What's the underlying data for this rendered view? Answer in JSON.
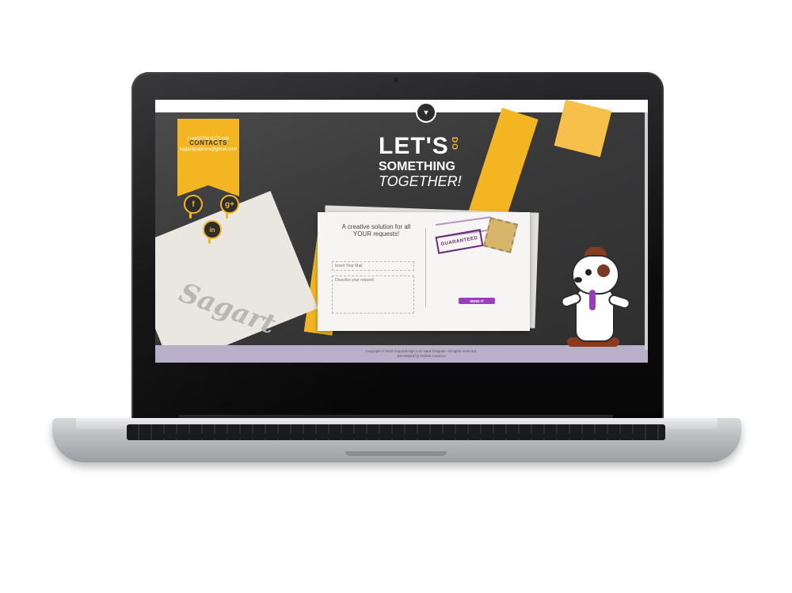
{
  "device": {
    "name": "laptop"
  },
  "page": {
    "contacts": {
      "title": "CONTACTS",
      "phone": "(+44)0758 6171499",
      "email": "sagartgraphics@gmail.com"
    },
    "social": [
      {
        "icon": "facebook-icon",
        "glyph": "f"
      },
      {
        "icon": "google-plus-icon",
        "glyph": "g+"
      },
      {
        "icon": "linkedin-icon",
        "glyph": "in"
      }
    ],
    "headline": {
      "line1": "LET'S",
      "do": "DO",
      "line2": "SOMETHING",
      "line3": "TOGETHER!"
    },
    "form": {
      "title": "A creative solution for all YOUR requests!",
      "mail_placeholder": "Insert Your Mail",
      "request_placeholder": "Describe your request",
      "send_label": "SEND IT",
      "postmark_text": "GUARANTEED"
    },
    "footer": {
      "copyright": "Copyright © 2015 sagartdesign.com Sara Dragotto. All rights reserved.",
      "developer": "Developed by Andrea Carasco"
    },
    "paper_logo_text": "Sagart"
  },
  "colors": {
    "accent": "#f4b523",
    "dark": "#3a3a3b",
    "purple": "#9c3ec0",
    "footer": "#b8afc8"
  }
}
